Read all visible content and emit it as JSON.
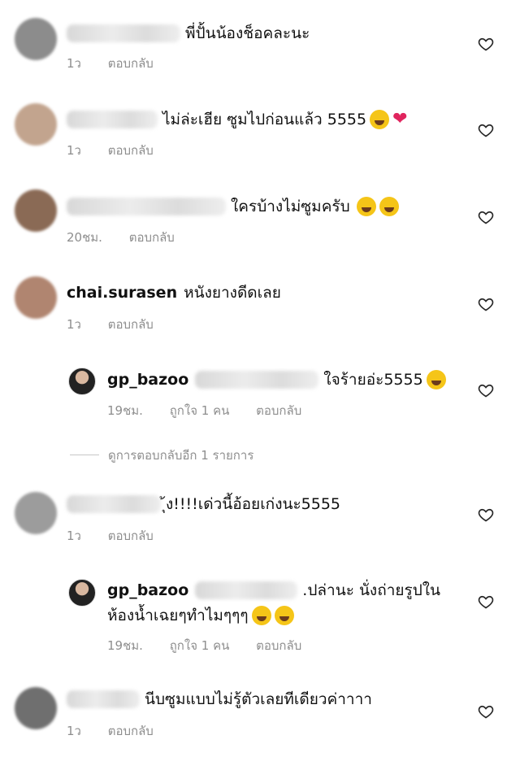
{
  "comments": [
    {
      "text": "พี่ปั้นน้องช็อคละนะ",
      "time": "1ว",
      "reply": "ตอบกลับ"
    },
    {
      "text": "ไม่ล่ะเฮีย ซูมไปก่อนแล้ว 5555",
      "time": "1ว",
      "reply": "ตอบกลับ"
    },
    {
      "text": "ใครบ้างไม่ซูมครับ",
      "time": "20ชม.",
      "reply": "ตอบกลับ"
    },
    {
      "username": "chai.surasen",
      "text": "หนังยางดีดเลย",
      "time": "1ว",
      "reply": "ตอบกลับ"
    },
    {
      "username": "gp_bazoo",
      "text": "ใจร้ายอ่ะ5555",
      "time": "19ชม.",
      "likes": "ถูกใจ 1 คน",
      "reply": "ตอบกลับ"
    },
    {
      "text": "ุ้ง!!!!เด่วนี้อ้อยเก่งนะ5555",
      "time": "1ว",
      "reply": "ตอบกลับ"
    },
    {
      "username": "gp_bazoo",
      "text_line1": ".ปล่านะ นั่งถ่ายรูปใน",
      "text_line2": "ห้องน้ำเฉยๆทำไมๆๆๆ",
      "time": "19ชม.",
      "likes": "ถูกใจ 1 คน",
      "reply": "ตอบกลับ"
    },
    {
      "text": "นีบซูมแบบไม่รู้ตัวเลยทีเดียวค่าาาา",
      "time": "1ว",
      "reply": "ตอบกลับ"
    }
  ],
  "more_replies": "ดูการตอบกลับอีก 1 รายการ",
  "icons": {
    "like": "heart-outline-icon",
    "emoji_laugh": "grinning-squinting-face-emoji",
    "emoji_rofl": "rolling-on-floor-laughing-emoji",
    "emoji_love": "heart-eyes-emoji"
  },
  "colors": {
    "meta": "#8e8e8e",
    "heart_red": "#e0245e"
  }
}
